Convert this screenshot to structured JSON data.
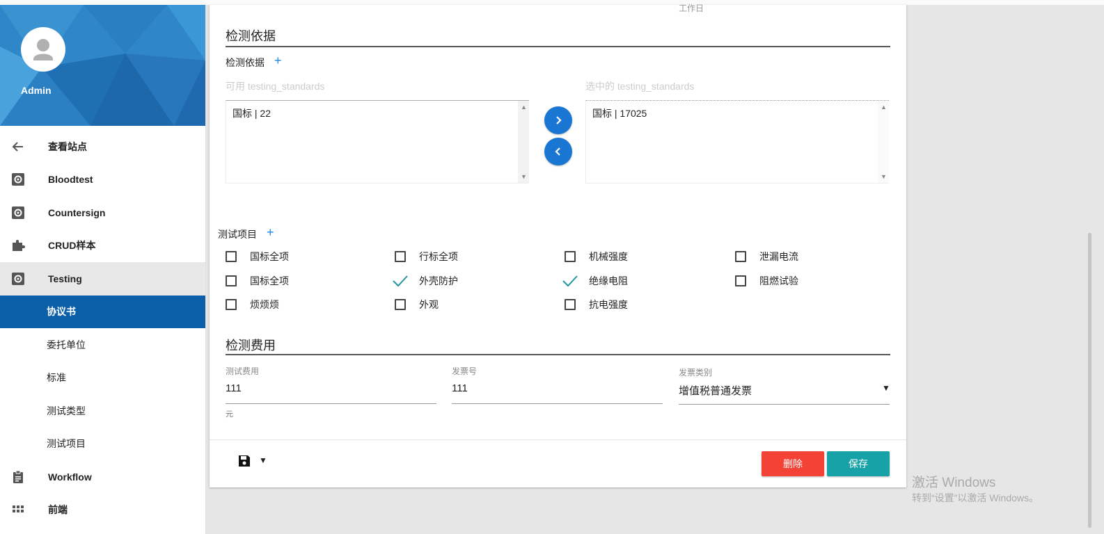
{
  "colors": {
    "primary": "#0b5ea8",
    "accent_blue": "#1976d2",
    "delete": "#f44336",
    "save": "#17a2a8",
    "check": "#2196a3"
  },
  "sidebar": {
    "user": "Admin",
    "items": [
      {
        "label": "查看站点",
        "icon": "arrow-left-icon"
      },
      {
        "label": "Bloodtest",
        "icon": "gear-icon"
      },
      {
        "label": "Countersign",
        "icon": "gear-icon"
      },
      {
        "label": "CRUD样本",
        "icon": "puzzle-icon"
      },
      {
        "label": "Testing",
        "icon": "gear-icon"
      },
      {
        "label": "协议书"
      },
      {
        "label": "委托单位"
      },
      {
        "label": "标准"
      },
      {
        "label": "测试类型"
      },
      {
        "label": "测试项目"
      },
      {
        "label": "Workflow",
        "icon": "clipboard-icon"
      },
      {
        "label": "前端",
        "icon": "grid-icon"
      }
    ]
  },
  "main": {
    "top_cut_text": "工作日",
    "section_basis": {
      "title": "检测依据",
      "field_label": "检测依据",
      "available_label": "可用 testing_standards",
      "selected_label": "选中的 testing_standards",
      "available": [
        "国标 | 22"
      ],
      "selected": [
        "国标 | 17025"
      ]
    },
    "test_items": {
      "label": "测试项目",
      "items": [
        {
          "label": "国标全项",
          "checked": false
        },
        {
          "label": "行标全项",
          "checked": false
        },
        {
          "label": "机械强度",
          "checked": false
        },
        {
          "label": "泄漏电流",
          "checked": false
        },
        {
          "label": "国标全项",
          "checked": false
        },
        {
          "label": "外壳防护",
          "checked": true
        },
        {
          "label": "绝缘电阻",
          "checked": true
        },
        {
          "label": "阻燃试验",
          "checked": false
        },
        {
          "label": "烦烦烦",
          "checked": false
        },
        {
          "label": "外观",
          "checked": false
        },
        {
          "label": "抗电强度",
          "checked": false
        }
      ]
    },
    "section_fee": {
      "title": "检测费用",
      "fee_label": "测试费用",
      "fee_value": "111",
      "fee_unit": "元",
      "invoice_no_label": "发票号",
      "invoice_no_value": "111",
      "invoice_type_label": "发票类别",
      "invoice_type_value": "增值税普通发票"
    },
    "footer": {
      "delete_label": "删除",
      "save_label": "保存"
    }
  },
  "watermark": {
    "line1": "激活 Windows",
    "line2": "转到“设置”以激活 Windows。"
  }
}
